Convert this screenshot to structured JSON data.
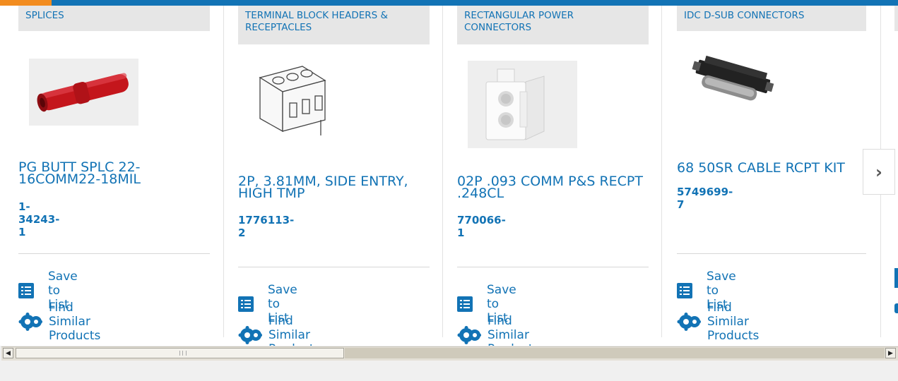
{
  "products": [
    {
      "category": "SPLICES",
      "title": "PG BUTT SPLC 22-16COMM22-18MIL",
      "part_number": "1-34243-1",
      "image_icon": "butt-splice-image",
      "save_label": "Save to List",
      "similar_label": "Find Similar Products"
    },
    {
      "category": "TERMINAL BLOCK HEADERS & RECEPTACLES",
      "title": "2P, 3.81MM, SIDE ENTRY, HIGH TMP",
      "part_number": "1776113-2",
      "image_icon": "terminal-block-image",
      "save_label": "Save to List",
      "similar_label": "Find Similar Products"
    },
    {
      "category": "RECTANGULAR POWER CONNECTORS",
      "title": "02P .093 COMM P&S RECPT .248CL",
      "part_number": "770066-1",
      "image_icon": "power-connector-image",
      "save_label": "Save to List",
      "similar_label": "Find Similar Products"
    },
    {
      "category": "IDC D-SUB CONNECTORS",
      "title": "68 50SR CABLE RCPT KIT",
      "part_number": "5749699-7",
      "image_icon": "dsub-connector-image",
      "save_label": "Save to List",
      "similar_label": "Find Similar Products"
    }
  ],
  "carousel": {
    "next_label": "›",
    "next_icon": "chevron-right-icon"
  },
  "scrollbar": {
    "left_arrow": "◀",
    "right_arrow": "▶"
  },
  "colors": {
    "brand": "#1273b5",
    "accent": "#f28c1f",
    "category_bg": "#e6e6e6"
  }
}
